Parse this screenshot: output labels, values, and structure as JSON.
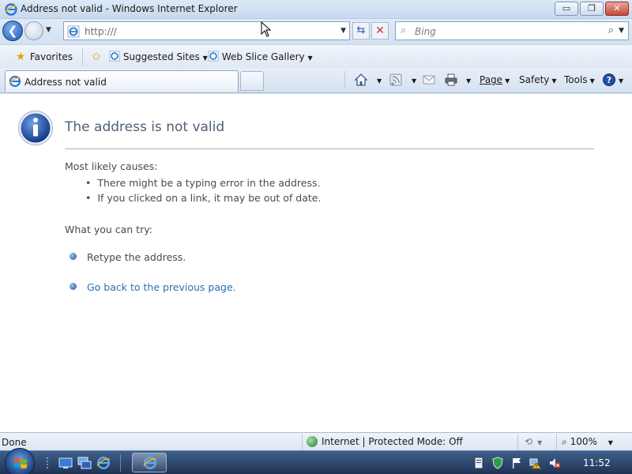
{
  "window": {
    "title": "Address not valid - Windows Internet Explorer",
    "min_glyph": "▭",
    "max_glyph": "❐",
    "close_glyph": "✕"
  },
  "nav": {
    "back_glyph": "❮",
    "address_value": "http:///",
    "search_placeholder": "Bing",
    "search_glyph": "⌕",
    "search_go_glyph": "⌕",
    "refresh_glyph": "⇆",
    "stop_glyph": "✕"
  },
  "favorites_bar": {
    "favorites_label": "Favorites",
    "suggested_sites_label": "Suggested Sites",
    "web_slice_gallery_label": "Web Slice Gallery"
  },
  "tabs": [
    {
      "label": "Address not valid"
    }
  ],
  "command_bar": {
    "page_label": "Page",
    "safety_label": "Safety",
    "tools_label": "Tools"
  },
  "content": {
    "title": "The address is not valid",
    "causes_heading": "Most likely causes:",
    "causes": [
      "There might be a typing error in the address.",
      "If you clicked on a link, it may be out of date."
    ],
    "try_heading": "What you can try:",
    "try_items": [
      "Retype the address.",
      "Go back to the previous page."
    ]
  },
  "status": {
    "left_text": "Done",
    "zone_text": "Internet | Protected Mode: Off",
    "zoom_text": "100%"
  },
  "taskbar": {
    "clock": "11:52"
  },
  "colors": {
    "link": "#2f6fb0",
    "title_text": "#4f5f74",
    "info_icon_blue": "#1e4fa8"
  }
}
